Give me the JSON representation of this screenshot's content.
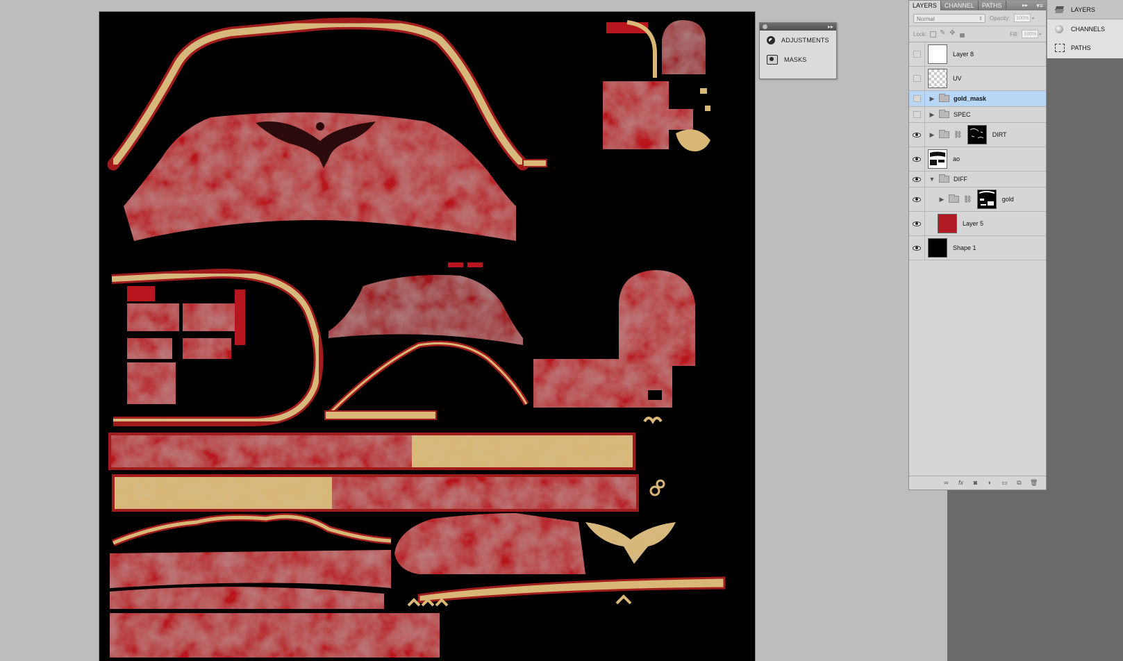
{
  "canvas": {
    "background": "#000000",
    "red": "#b8161f",
    "gold": "#d9b877"
  },
  "float_panel": {
    "items": [
      {
        "label": "ADJUSTMENTS",
        "icon": "adjustments-icon"
      },
      {
        "label": "MASKS",
        "icon": "masks-icon"
      }
    ]
  },
  "layers_panel": {
    "tabs": [
      "LAYERS",
      "CHANNEL",
      "PATHS"
    ],
    "blend_mode": "Normal",
    "opacity_label": "Opacity:",
    "opacity_value": "100%",
    "lock_label": "Lock:",
    "fill_label": "Fill:",
    "fill_value": "100%",
    "layers": [
      {
        "name": "Layer 8",
        "visible": false,
        "type": "layer",
        "thumb": "white"
      },
      {
        "name": "UV",
        "visible": false,
        "type": "layer",
        "thumb": "checker"
      },
      {
        "name": "gold_mask",
        "visible": false,
        "type": "group",
        "expanded": false,
        "selected": true
      },
      {
        "name": "SPEC",
        "visible": false,
        "type": "group",
        "expanded": false
      },
      {
        "name": "DIRT",
        "visible": true,
        "type": "group-mask",
        "expanded": false
      },
      {
        "name": "ao",
        "visible": true,
        "type": "layer",
        "thumb": "ao"
      },
      {
        "name": "DIFF",
        "visible": true,
        "type": "group",
        "expanded": true
      },
      {
        "name": "gold",
        "visible": true,
        "type": "group-mask",
        "expanded": false,
        "indented": true
      },
      {
        "name": "Layer 5",
        "visible": true,
        "type": "layer",
        "thumb": "red",
        "indented": true
      },
      {
        "name": "Shape 1",
        "visible": true,
        "type": "layer",
        "thumb": "black"
      }
    ]
  },
  "dock": {
    "items": [
      {
        "label": "LAYERS",
        "icon": "layers-icon",
        "active": true
      },
      {
        "label": "CHANNELS",
        "icon": "channels-icon",
        "active": false
      },
      {
        "label": "PATHS",
        "icon": "paths-icon",
        "active": false
      }
    ]
  }
}
